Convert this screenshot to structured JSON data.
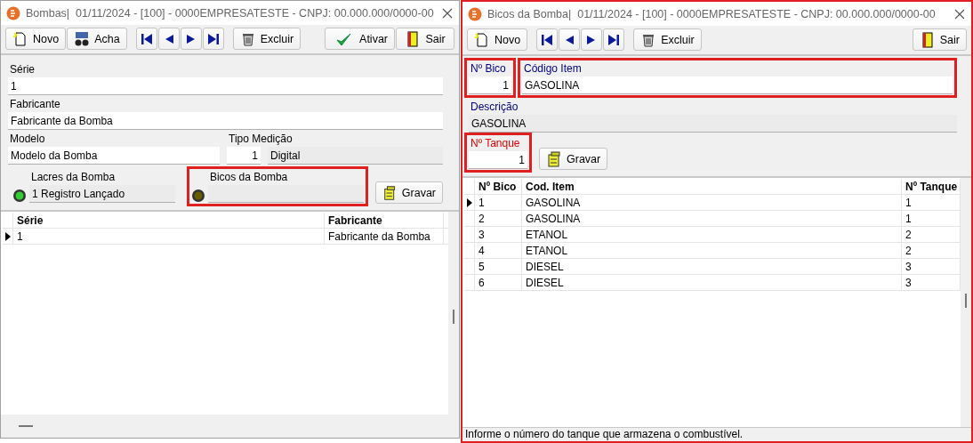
{
  "bombas_window": {
    "title": "Bombas|  01/11/2024 - [100] - 0000EMPRESATESTE - CNPJ: 00.000.000/0000-00",
    "highlighted": false,
    "toolbar": [
      [
        {
          "kind": "new",
          "label": "Novo"
        },
        {
          "kind": "find",
          "label": "Acha"
        }
      ],
      [
        {
          "kind": "first"
        },
        {
          "kind": "prev"
        },
        {
          "kind": "next"
        },
        {
          "kind": "last"
        }
      ],
      [
        {
          "kind": "delete",
          "label": "Excluir"
        }
      ],
      [
        {
          "kind": "activate",
          "label": "Ativar"
        },
        {
          "kind": "exit",
          "label": "Sair"
        }
      ]
    ],
    "serie": {
      "label": "Série",
      "value": "1"
    },
    "fabricante": {
      "label": "Fabricante",
      "value": "Fabricante da Bomba"
    },
    "modelo": {
      "label": "Modelo",
      "value": "Modelo da Bomba"
    },
    "tipo_medicao": {
      "label": "Tipo Medição",
      "code": "1",
      "description": "Digital"
    },
    "lacres": {
      "label": "Lacres da Bomba",
      "value": "1 Registro Lançado",
      "on": true,
      "highlighted": false
    },
    "bicos": {
      "label": "Bicos da Bomba",
      "on": false,
      "highlighted": true
    },
    "save_button": {
      "label": "Gravar"
    },
    "table": {
      "columns": [
        "Série",
        "Fabricante"
      ],
      "rows": [
        {
          "cells": [
            "1",
            "Fabricante da Bomba"
          ],
          "selected": true
        }
      ]
    }
  },
  "bicos_window": {
    "title": "Bicos da Bomba|  01/11/2024 - [100] - 0000EMPRESATESTE - CNPJ: 00.000.000/0000-00",
    "highlighted": true,
    "toolbar": [
      [
        {
          "kind": "new",
          "label": "Novo"
        }
      ],
      [
        {
          "kind": "first"
        },
        {
          "kind": "prev"
        },
        {
          "kind": "next"
        },
        {
          "kind": "last"
        }
      ],
      [
        {
          "kind": "delete",
          "label": "Excluir"
        }
      ],
      [
        {
          "kind": "exit",
          "label": "Sair"
        }
      ]
    ],
    "numero_bico": {
      "label": "Nº Bico",
      "value": "1",
      "highlighted": true,
      "focused": false
    },
    "codigo_item": {
      "label": "Código Item",
      "value": "GASOLINA",
      "highlighted": true,
      "focused": false
    },
    "descricao": {
      "label": "Descrição",
      "value": "GASOLINA"
    },
    "numero_tanque": {
      "label": "Nº Tanque",
      "value": "1",
      "highlighted": true,
      "focused": true
    },
    "save_button": {
      "label": "Gravar"
    },
    "table": {
      "columns": [
        "Nº Bico",
        "Cod. Item",
        "Nº Tanque"
      ],
      "rows": [
        {
          "cells": [
            "1",
            "GASOLINA",
            "1"
          ],
          "selected": true
        },
        {
          "cells": [
            "2",
            "GASOLINA",
            "1"
          ],
          "selected": false
        },
        {
          "cells": [
            "3",
            "ETANOL",
            "2"
          ],
          "selected": false
        },
        {
          "cells": [
            "4",
            "ETANOL",
            "2"
          ],
          "selected": false
        },
        {
          "cells": [
            "5",
            "DIESEL",
            "3"
          ],
          "selected": false
        },
        {
          "cells": [
            "6",
            "DIESEL",
            "3"
          ],
          "selected": false
        }
      ]
    },
    "status_bar": "Informe o número do tanque que armazena o combustível."
  }
}
